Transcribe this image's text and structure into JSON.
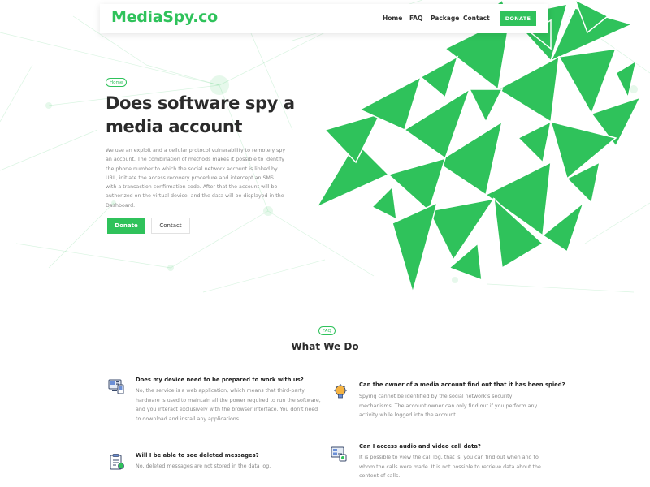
{
  "colors": {
    "accent": "#2fc25b",
    "text": "#2b2b2b",
    "muted": "#8a8a8a"
  },
  "header": {
    "brand": "MediaSpy.co",
    "nav": [
      "Home",
      "FAQ",
      "Package",
      "Contact"
    ],
    "donate": "DONATE"
  },
  "hero": {
    "badge": "Home",
    "title": "Does software spy a media account",
    "text": "We use an exploit and a cellular protocol vulnerability to remotely spy an account. The combination of methods makes it possible to identify the phone number to which the social network account is linked by URL, initiate the access recovery procedure and intercept an SMS with a transaction confirmation code. After that the account will be authorized on the virtual device, and the data will be displayed in the Dashboard.",
    "donate_button": "Donate",
    "contact_button": "Contact"
  },
  "section": {
    "badge": "FAQ",
    "title": "What We Do"
  },
  "faqs": [
    {
      "icon": "devices-icon",
      "question": "Does my device need to be prepared to work with us?",
      "answer": "No, the service is a web application, which means that third-party hardware is used to maintain all the power required to run the software, and you interact exclusively with the browser interface. You don't need to download and install any applications."
    },
    {
      "icon": "lightbulb-icon",
      "question": "Can the owner of a media account find out that it has been spied?",
      "answer": "Spying cannot be identified by the social network's security mechanisms. The account owner can only find out if you perform any activity while logged into the account."
    },
    {
      "icon": "clipboard-icon",
      "question": "Will I be able to see deleted messages?",
      "answer": "No, deleted messages are not stored in the data log."
    },
    {
      "icon": "call-log-icon",
      "question": "Can I access audio and video call data?",
      "answer": "It is possible to view the call log, that is, you can find out when and to whom the calls were made. It is not possible to retrieve data about the content of calls."
    }
  ]
}
